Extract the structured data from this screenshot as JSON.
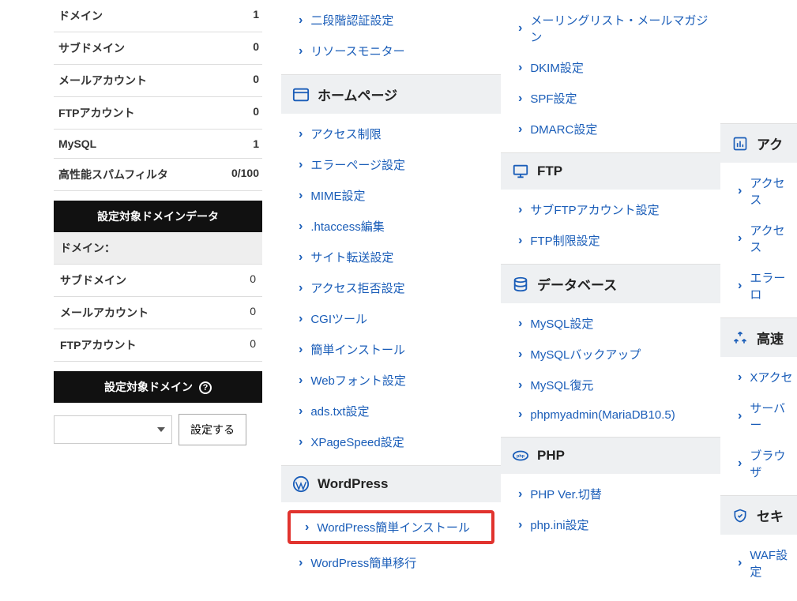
{
  "sidebar": {
    "stats": [
      {
        "label": "ドメイン",
        "value": "1"
      },
      {
        "label": "サブドメイン",
        "value": "0"
      },
      {
        "label": "メールアカウント",
        "value": "0"
      },
      {
        "label": "FTPアカウント",
        "value": "0"
      },
      {
        "label": "MySQL",
        "value": "1"
      },
      {
        "label": "高性能スパムフィルタ",
        "value": "0/100"
      }
    ],
    "domain_data_title": "設定対象ドメインデータ",
    "domain_data": [
      {
        "label": "ドメイン：",
        "value": ""
      },
      {
        "label": "サブドメイン",
        "value": "0"
      },
      {
        "label": "メールアカウント",
        "value": "0"
      },
      {
        "label": "FTPアカウント",
        "value": "0"
      }
    ],
    "target_domain_title": "設定対象ドメイン",
    "set_button": "設定する"
  },
  "col1": {
    "top_links": [
      "二段階認証設定",
      "リソースモニター"
    ],
    "homepage": {
      "title": "ホームページ",
      "links": [
        "アクセス制限",
        "エラーページ設定",
        "MIME設定",
        ".htaccess編集",
        "サイト転送設定",
        "アクセス拒否設定",
        "CGIツール",
        "簡単インストール",
        "Webフォント設定",
        "ads.txt設定",
        "XPageSpeed設定"
      ]
    },
    "wordpress": {
      "title": "WordPress",
      "links": [
        "WordPress簡単インストール",
        "WordPress簡単移行"
      ]
    }
  },
  "col2": {
    "top_links": [
      "メーリングリスト・メールマガジン",
      "DKIM設定",
      "SPF設定",
      "DMARC設定"
    ],
    "ftp": {
      "title": "FTP",
      "links": [
        "サブFTPアカウント設定",
        "FTP制限設定"
      ]
    },
    "database": {
      "title": "データベース",
      "links": [
        "MySQL設定",
        "MySQLバックアップ",
        "MySQL復元",
        "phpmyadmin(MariaDB10.5)"
      ]
    },
    "php": {
      "title": "PHP",
      "links": [
        "PHP Ver.切替",
        "php.ini設定"
      ]
    }
  },
  "col3": {
    "access": {
      "title": "アク",
      "links": [
        "アクセス",
        "アクセス",
        "エラーロ"
      ]
    },
    "speed": {
      "title": "高速",
      "links": [
        "Xアクセ",
        "サーバー",
        "ブラウザ"
      ]
    },
    "security": {
      "title": "セキ",
      "links": [
        "WAF設定"
      ]
    }
  }
}
